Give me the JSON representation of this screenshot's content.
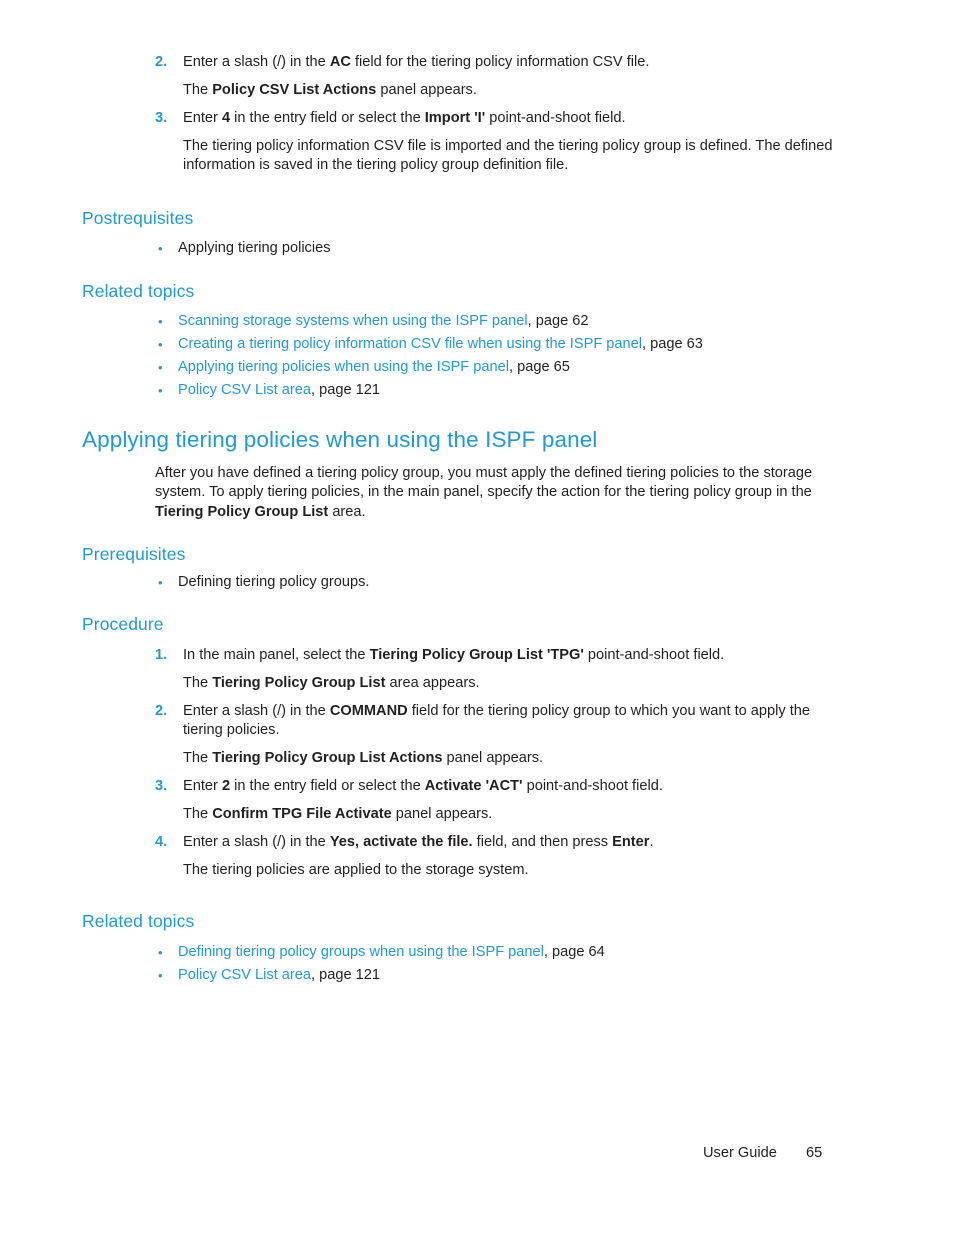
{
  "document": {
    "colors": {
      "heading_blue": "#1f9ad6",
      "link_blue": "#1f9ad6",
      "body_black": "#231f20"
    }
  },
  "top_steps": [
    {
      "number": "2.",
      "parts": [
        {
          "text": "Enter a slash (/) in the ",
          "style": "normal"
        },
        {
          "text": "AC",
          "style": "bold"
        },
        {
          "text": " field for the tiering policy information CSV file.",
          "style": "normal"
        }
      ]
    },
    {
      "number": "",
      "parts": [
        {
          "text": "The ",
          "style": "normal"
        },
        {
          "text": "Policy CSV List Actions",
          "style": "bold"
        },
        {
          "text": " panel appears.",
          "style": "normal"
        }
      ]
    },
    {
      "number": "3.",
      "parts": [
        {
          "text": "Enter ",
          "style": "normal"
        },
        {
          "text": "4",
          "style": "bold"
        },
        {
          "text": " in the entry field or select the ",
          "style": "normal"
        },
        {
          "text": "Import 'I'",
          "style": "bold"
        },
        {
          "text": " point-and-shoot field.",
          "style": "normal"
        }
      ]
    },
    {
      "number": "",
      "parts": [
        {
          "text": "The tiering policy information CSV file is imported and the tiering policy group is defined. The defined information is saved in the tiering policy group definition file.",
          "style": "normal"
        }
      ]
    }
  ],
  "postrequisites": {
    "heading": "Postrequisites",
    "items": [
      {
        "parts": [
          {
            "text": "Applying tiering policies",
            "style": "normal"
          }
        ]
      }
    ]
  },
  "related_topics_1": {
    "heading": "Related topics",
    "items": [
      {
        "parts": [
          {
            "text": "Scanning storage systems when using the ISPF panel",
            "style": "link"
          },
          {
            "text": ", page 62",
            "style": "normal"
          }
        ]
      },
      {
        "parts": [
          {
            "text": "Creating a tiering policy information CSV file when using the ISPF panel",
            "style": "link"
          },
          {
            "text": ", page 63",
            "style": "normal"
          }
        ]
      },
      {
        "parts": [
          {
            "text": "Applying tiering policies when using the ISPF panel",
            "style": "link"
          },
          {
            "text": ", page 65",
            "style": "normal"
          }
        ]
      },
      {
        "parts": [
          {
            "text": "Policy CSV List area",
            "style": "link"
          },
          {
            "text": ", page 121",
            "style": "normal"
          }
        ]
      }
    ]
  },
  "chapter": {
    "title": "Applying tiering policies when using the ISPF panel",
    "intro_parts": [
      {
        "text": "After you have defined a tiering policy group, you must apply the defined tiering policies to the storage system. To apply tiering policies, in the main panel, specify the action for the tiering policy group in the ",
        "style": "normal"
      },
      {
        "text": "Tiering Policy Group List",
        "style": "bold"
      },
      {
        "text": " area.",
        "style": "normal"
      }
    ]
  },
  "prerequisites": {
    "heading": "Prerequisites",
    "items": [
      {
        "parts": [
          {
            "text": "Defining tiering policy groups.",
            "style": "normal"
          }
        ]
      }
    ]
  },
  "procedure": {
    "heading": "Procedure",
    "steps": [
      {
        "number": "1.",
        "parts": [
          {
            "text": "In the main panel, select the ",
            "style": "normal"
          },
          {
            "text": "Tiering Policy Group List 'TPG'",
            "style": "bold"
          },
          {
            "text": " point-and-shoot field.",
            "style": "normal"
          }
        ]
      },
      {
        "number": "",
        "parts": [
          {
            "text": "The ",
            "style": "normal"
          },
          {
            "text": "Tiering Policy Group List",
            "style": "bold"
          },
          {
            "text": " area appears.",
            "style": "normal"
          }
        ]
      },
      {
        "number": "2.",
        "parts": [
          {
            "text": "Enter a slash (/) in the ",
            "style": "normal"
          },
          {
            "text": "COMMAND",
            "style": "bold"
          },
          {
            "text": " field for the tiering policy group to which you want to apply the tiering policies.",
            "style": "normal"
          }
        ]
      },
      {
        "number": "",
        "parts": [
          {
            "text": "The ",
            "style": "normal"
          },
          {
            "text": "Tiering Policy Group List Actions",
            "style": "bold"
          },
          {
            "text": " panel appears.",
            "style": "normal"
          }
        ]
      },
      {
        "number": "3.",
        "parts": [
          {
            "text": "Enter ",
            "style": "normal"
          },
          {
            "text": "2",
            "style": "bold"
          },
          {
            "text": " in the entry field or select the ",
            "style": "normal"
          },
          {
            "text": "Activate 'ACT'",
            "style": "bold"
          },
          {
            "text": " point-and-shoot field.",
            "style": "normal"
          }
        ]
      },
      {
        "number": "",
        "parts": [
          {
            "text": "The ",
            "style": "normal"
          },
          {
            "text": "Confirm TPG File Activate",
            "style": "bold"
          },
          {
            "text": " panel appears.",
            "style": "normal"
          }
        ]
      },
      {
        "number": "4.",
        "parts": [
          {
            "text": "Enter a slash (/) in the ",
            "style": "normal"
          },
          {
            "text": "Yes, activate the file.",
            "style": "bold"
          },
          {
            "text": " field, and then press ",
            "style": "normal"
          },
          {
            "text": "Enter",
            "style": "bold"
          },
          {
            "text": ".",
            "style": "normal"
          }
        ]
      },
      {
        "number": "",
        "parts": [
          {
            "text": "The tiering policies are applied to the storage system.",
            "style": "normal"
          }
        ]
      }
    ]
  },
  "related_topics_2": {
    "heading": "Related topics",
    "items": [
      {
        "parts": [
          {
            "text": "Defining tiering policy groups when using the ISPF panel",
            "style": "link"
          },
          {
            "text": ", page 64",
            "style": "normal"
          }
        ]
      },
      {
        "parts": [
          {
            "text": "Policy CSV List area",
            "style": "link"
          },
          {
            "text": ", page 121",
            "style": "normal"
          }
        ]
      }
    ]
  },
  "footer": {
    "label": "User Guide",
    "page_number": "65"
  }
}
